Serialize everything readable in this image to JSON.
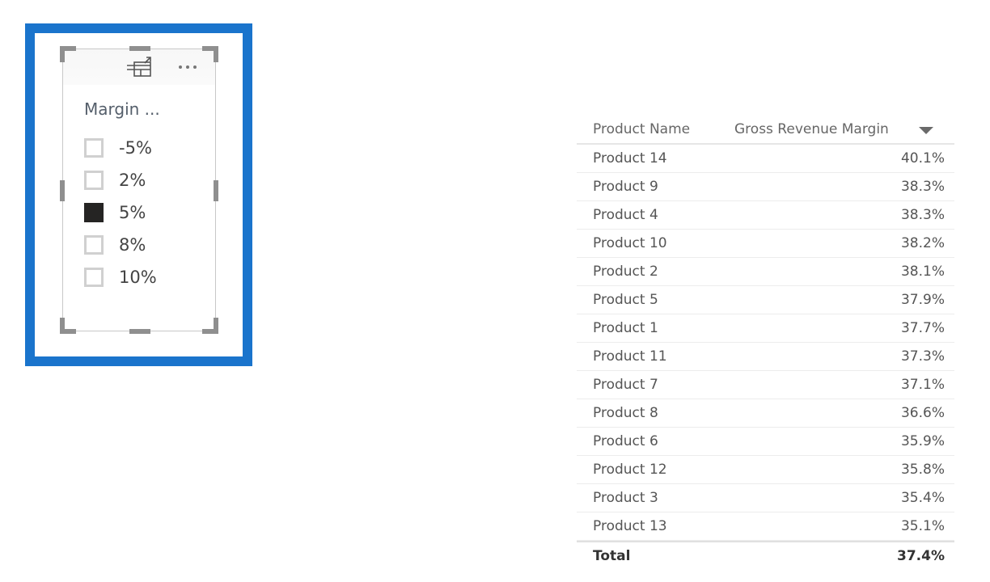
{
  "slicer": {
    "title": "Margin ...",
    "focus_icon": "focus-mode-icon",
    "more_icon": "more-options-icon",
    "selection_color": "#252423",
    "frame_color": "#1a74cc",
    "items": [
      {
        "label": "-5%",
        "checked": false
      },
      {
        "label": "2%",
        "checked": false
      },
      {
        "label": "5%",
        "checked": true
      },
      {
        "label": "8%",
        "checked": false
      },
      {
        "label": "10%",
        "checked": false
      }
    ]
  },
  "table": {
    "columns": [
      "Product Name",
      "Gross Revenue Margin"
    ],
    "sort": {
      "column": "Gross Revenue Margin",
      "direction": "descending",
      "icon": "sort-descending-icon"
    },
    "rows": [
      {
        "name": "Product 14",
        "value": "40.1%"
      },
      {
        "name": "Product 9",
        "value": "38.3%"
      },
      {
        "name": "Product 4",
        "value": "38.3%"
      },
      {
        "name": "Product 10",
        "value": "38.2%"
      },
      {
        "name": "Product 2",
        "value": "38.1%"
      },
      {
        "name": "Product 5",
        "value": "37.9%"
      },
      {
        "name": "Product 1",
        "value": "37.7%"
      },
      {
        "name": "Product 11",
        "value": "37.3%"
      },
      {
        "name": "Product 7",
        "value": "37.1%"
      },
      {
        "name": "Product 8",
        "value": "36.6%"
      },
      {
        "name": "Product 6",
        "value": "35.9%"
      },
      {
        "name": "Product 12",
        "value": "35.8%"
      },
      {
        "name": "Product 3",
        "value": "35.4%"
      },
      {
        "name": "Product 13",
        "value": "35.1%"
      }
    ],
    "total": {
      "label": "Total",
      "value": "37.4%"
    }
  }
}
